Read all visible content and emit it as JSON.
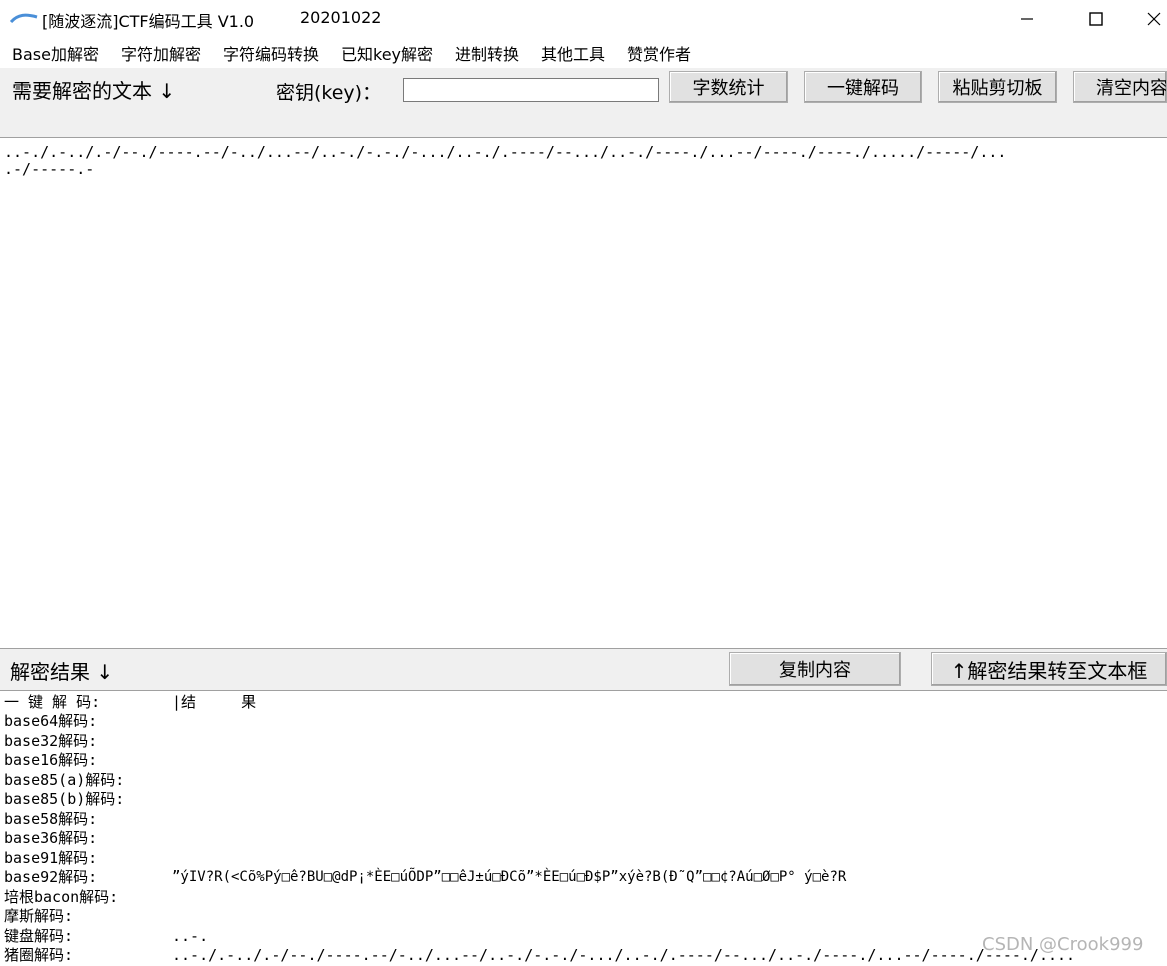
{
  "window": {
    "title": "[随波逐流]CTF编码工具 V1.0",
    "date": "20201022"
  },
  "menu": [
    "Base加解密",
    "字符加解密",
    "字符编码转换",
    "已知key解密",
    "进制转换",
    "其他工具",
    "赞赏作者"
  ],
  "toolbar": {
    "input_label": "需要解密的文本 ↓",
    "key_label": "密钥(key)：",
    "key_value": "",
    "buttons": {
      "count": "字数统计",
      "one_click": "一键解码",
      "paste": "粘贴剪切板",
      "clear": "清空内容"
    }
  },
  "input_text": {
    "line1": "..-./.-../.-/--./----.--/-../...--/..-./-.-./-.../..-./.----/--.../..-./----./...--/----./----./...../-----/...",
    "line2": ".-/-----.-"
  },
  "result_bar": {
    "label": "解密结果 ↓",
    "copy_button": "复制内容",
    "to_textbox_button": "↑解密结果转至文本框"
  },
  "results": {
    "header": {
      "name": "一 键 解 码:",
      "value": "|结     果"
    },
    "rows": [
      {
        "name": "base64解码:",
        "value": ""
      },
      {
        "name": "base32解码:",
        "value": ""
      },
      {
        "name": "base16解码:",
        "value": ""
      },
      {
        "name": "base85(a)解码:",
        "value": ""
      },
      {
        "name": "base85(b)解码:",
        "value": ""
      },
      {
        "name": "base58解码:",
        "value": ""
      },
      {
        "name": "base36解码:",
        "value": ""
      },
      {
        "name": "base91解码:",
        "value": ""
      },
      {
        "name": "base92解码:",
        "value": "”ýIV?R(<Cõ%Pý□ê?BU□@dP¡*ÈE□úÕDP”□□êJ±ú□ÐCõ”*ÈE□ú□Ð$P”xýè?B(Ð˜Q”□□¢?Aú□Ø□P° ý□è?R"
      },
      {
        "name": "培根bacon解码:",
        "value": ""
      },
      {
        "name": "摩斯解码:",
        "value": ""
      },
      {
        "name": "键盘解码:",
        "value": "..-."
      },
      {
        "name": "猪圈解码:",
        "value": "..-./.-../.-/--./----.--/-../...--/..-./-.-./-.../..-./.----/--.../..-./----./...--/----./----./...."
      }
    ]
  },
  "watermark": "CSDN @Crook999"
}
